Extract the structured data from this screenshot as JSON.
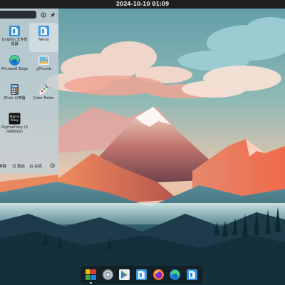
{
  "topbar": {
    "datetime": "2024-10-10 01:09"
  },
  "launcher": {
    "search": {
      "value": "",
      "placeholder": ""
    },
    "apps": [
      {
        "label": "Dolphin 文件管理器",
        "icon": "dolphin-icon"
      },
      {
        "label": "Nemo",
        "icon": "nemo-icon",
        "selected": true
      },
      {
        "label": "Microsoft Edge",
        "icon": "edge-icon"
      },
      {
        "label": "gThumb",
        "icon": "gthumb-icon"
      },
      {
        "label": "KCalc 计算器",
        "icon": "kcalc-icon"
      },
      {
        "label": "Color Picker",
        "icon": "color-picker-icon"
      },
      {
        "label": "PigchaProxy (30e89fe2)",
        "icon": "pigcha-icon",
        "icon_text": "Pigcha Proxy"
      }
    ],
    "footer": {
      "sleep": "睡眠",
      "restart": "重启",
      "shutdown": "关机"
    }
  },
  "dock": {
    "items": [
      "launcher-icon",
      "settings-icon",
      "play-store-icon",
      "nemo-icon",
      "firefox-icon",
      "edge-icon",
      "dolphin-icon"
    ]
  },
  "colors": {
    "topbar": "#1f1f22",
    "accent_blue": "#2f8fe0"
  }
}
